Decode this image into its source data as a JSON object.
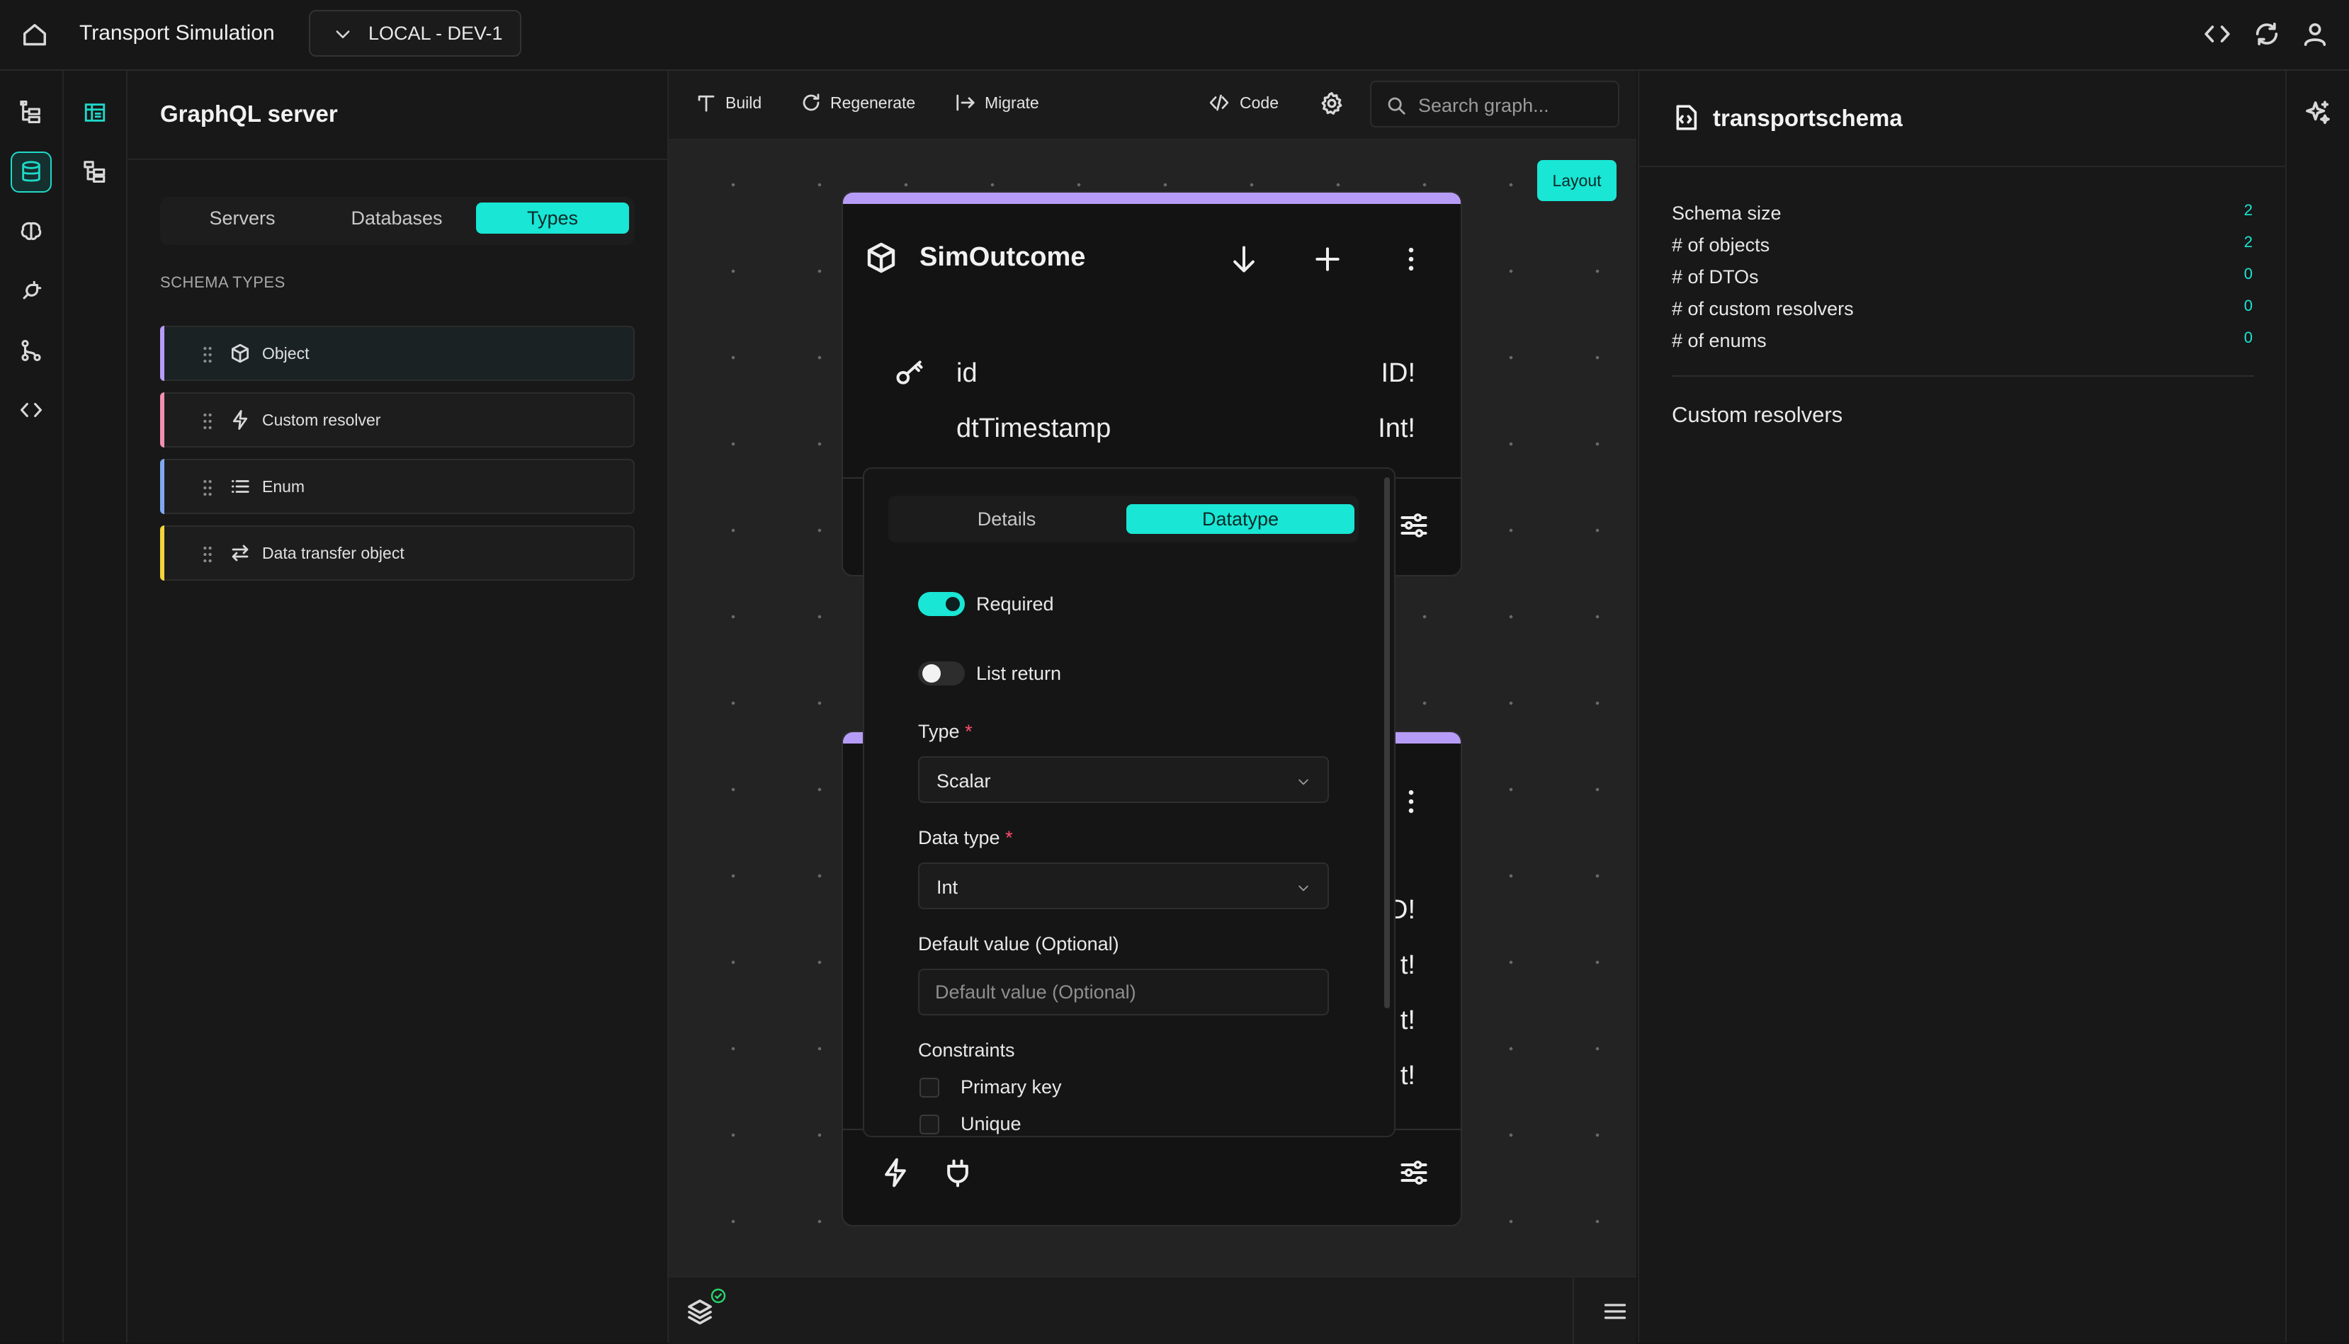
{
  "header": {
    "title": "Transport Simulation",
    "environment": "LOCAL - DEV-1"
  },
  "sidebar": {
    "title": "GraphQL server",
    "tabs": [
      {
        "label": "Servers"
      },
      {
        "label": "Databases"
      },
      {
        "label": "Types"
      }
    ],
    "active_tab": "Types",
    "section_label": "SCHEMA TYPES",
    "types": [
      {
        "label": "Object",
        "icon": "cube-icon",
        "color": "#b79cf7"
      },
      {
        "label": "Custom resolver",
        "icon": "bolt-icon",
        "color": "#f28fb0"
      },
      {
        "label": "Enum",
        "icon": "list-icon",
        "color": "#7fa8f0"
      },
      {
        "label": "Data transfer object",
        "icon": "arrows-icon",
        "color": "#f5d33c"
      }
    ]
  },
  "toolbar": {
    "build": "Build",
    "regenerate": "Regenerate",
    "migrate": "Migrate",
    "code": "Code",
    "search_placeholder": "Search graph..."
  },
  "canvas": {
    "layout_button": "Layout",
    "node1": {
      "title": "SimOutcome",
      "fields": [
        {
          "name": "id",
          "type": "ID!"
        },
        {
          "name": "dtTimestamp",
          "type": "Int!"
        }
      ]
    },
    "node2": {
      "partial_types": [
        "D!",
        "t!",
        "t!",
        "t!"
      ]
    }
  },
  "popup": {
    "tabs": [
      {
        "label": "Details"
      },
      {
        "label": "Datatype"
      }
    ],
    "active_tab": "Datatype",
    "required_label": "Required",
    "required_on": true,
    "list_return_label": "List return",
    "list_return_on": false,
    "type_label": "Type",
    "type_value": "Scalar",
    "data_type_label": "Data type",
    "data_type_value": "Int",
    "default_label": "Default value (Optional)",
    "default_placeholder": "Default value (Optional)",
    "constraints_label": "Constraints",
    "constraints": [
      {
        "label": "Primary key",
        "checked": false
      },
      {
        "label": "Unique",
        "checked": false
      }
    ]
  },
  "right_panel": {
    "schema_name": "transportschema",
    "stats": [
      {
        "label": "Schema size",
        "value": "2"
      },
      {
        "label": "# of objects",
        "value": "2"
      },
      {
        "label": "# of DTOs",
        "value": "0"
      },
      {
        "label": "# of custom resolvers",
        "value": "0"
      },
      {
        "label": "# of enums",
        "value": "0"
      }
    ],
    "resolvers_title": "Custom resolvers"
  },
  "colors": {
    "accent": "#19e6d4",
    "object_accent": "#b79cf7"
  }
}
